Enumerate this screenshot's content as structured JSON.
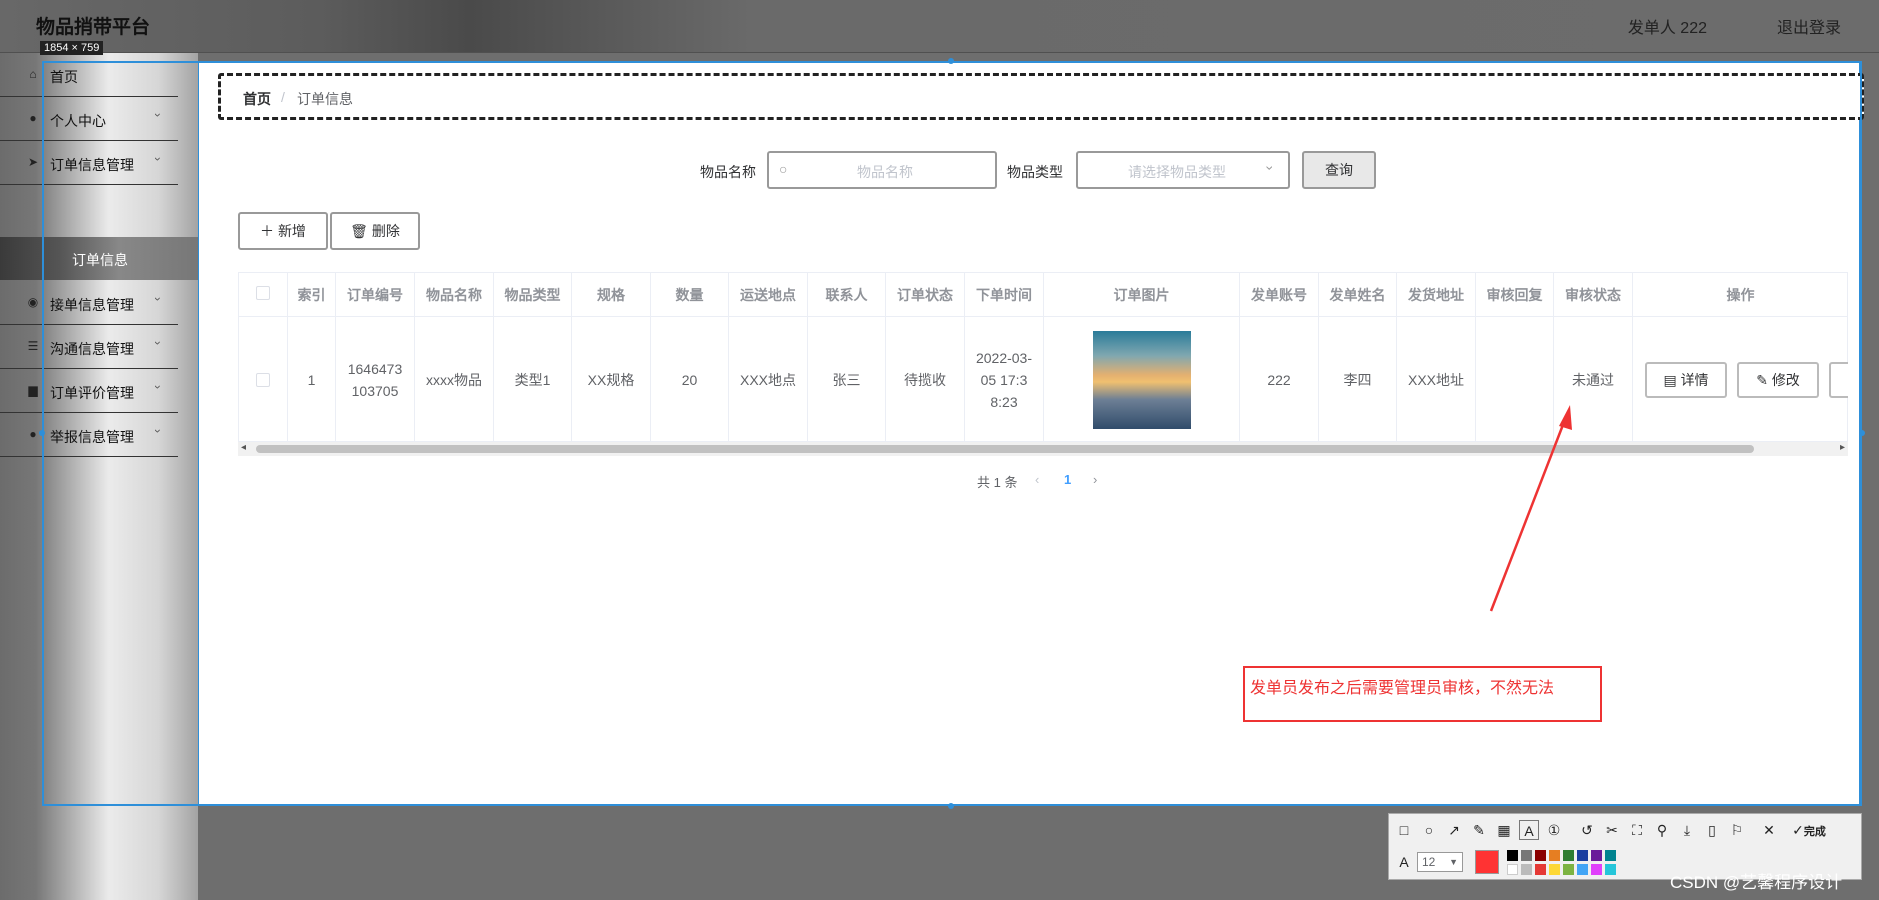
{
  "app": {
    "title": "物品捎带平台",
    "user_label": "发单人 222",
    "logout": "退出登录",
    "size_badge": "1854 × 759"
  },
  "sidebar": {
    "items": [
      {
        "label": "首页",
        "icon": "home-icon"
      },
      {
        "label": "个人中心",
        "icon": "user-icon"
      },
      {
        "label": "订单信息管理",
        "icon": "send-icon"
      },
      {
        "label": "接单信息管理",
        "icon": "location-icon"
      },
      {
        "label": "沟通信息管理",
        "icon": "sliders-icon"
      },
      {
        "label": "订单评价管理",
        "icon": "document-icon"
      },
      {
        "label": "举报信息管理",
        "icon": "user-icon"
      }
    ],
    "active_sub": "订单信息"
  },
  "breadcrumb": {
    "home": "首页",
    "sep": "/",
    "current": "订单信息"
  },
  "search": {
    "name_label": "物品名称",
    "name_placeholder": "物品名称",
    "type_label": "物品类型",
    "type_placeholder": "请选择物品类型",
    "query_button": "查询"
  },
  "actions": {
    "add": "新增",
    "delete": "删除",
    "add_icon": "plus-icon",
    "delete_icon": "trash-icon"
  },
  "table": {
    "headers": [
      "索引",
      "订单编号",
      "物品名称",
      "物品类型",
      "规格",
      "数量",
      "运送地点",
      "联系人",
      "订单状态",
      "下单时间",
      "订单图片",
      "发单账号",
      "发单姓名",
      "发货地址",
      "审核回复",
      "审核状态",
      "操作"
    ],
    "rows": [
      {
        "index": "1",
        "order_no": "1646473103705",
        "name": "xxxx物品",
        "type": "类型1",
        "spec": "XX规格",
        "qty": "20",
        "place": "XXX地点",
        "contact": "张三",
        "status": "待揽收",
        "time": "2022-03-05 17:38:23",
        "account": "222",
        "sender": "李四",
        "address": "XXX地址",
        "reply": "",
        "audit": "未通过"
      }
    ],
    "op_buttons": [
      "详情",
      "修改"
    ]
  },
  "pagination": {
    "total": "共 1 条",
    "page": "1"
  },
  "annotation": {
    "text": "发单员发布之后需要管理员审核，不然无法"
  },
  "screenshot_toolbar": {
    "done": "完成",
    "font_size": "12",
    "color": "#ff3333"
  },
  "watermark": "CSDN @艺馨程序设计"
}
